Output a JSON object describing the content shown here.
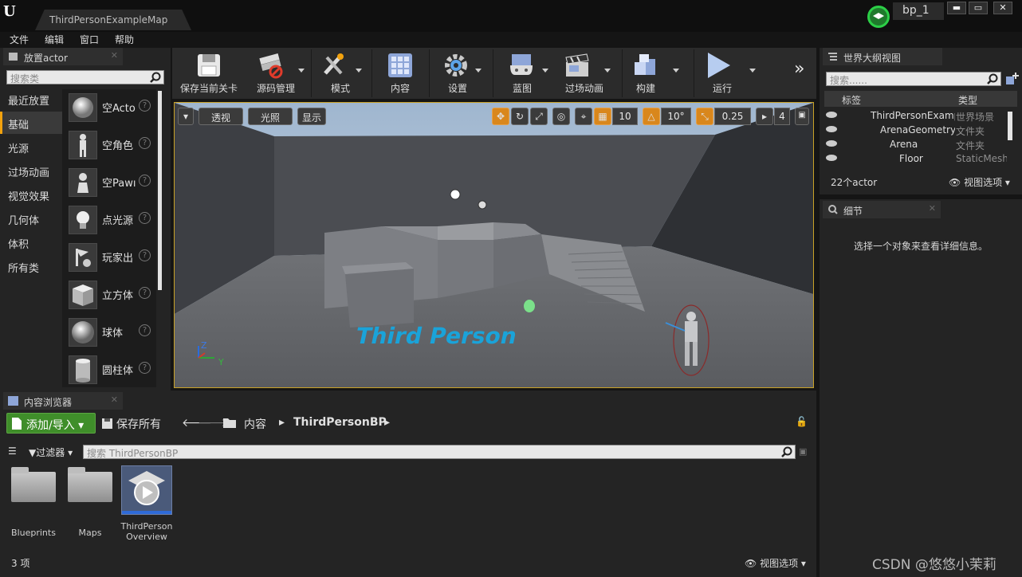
{
  "window": {
    "map_tab": "ThirdPersonExampleMap",
    "project_name": "bp_1",
    "minimize": "▬",
    "maximize": "▭",
    "close": "✕"
  },
  "menu": [
    "文件",
    "编辑",
    "窗口",
    "帮助"
  ],
  "place_actor": {
    "tab_title": "放置actor",
    "search_placeholder": "搜索类",
    "categories": [
      "最近放置",
      "基础",
      "光源",
      "过场动画",
      "视觉效果",
      "几何体",
      "体积",
      "所有类"
    ],
    "active_category": "基础",
    "actors": [
      "空Acto",
      "空角色",
      "空Pawı",
      "点光源",
      "玩家出",
      "立方体",
      "球体",
      "圆柱体"
    ],
    "help_glyph": "?"
  },
  "toolbar": {
    "items": [
      "保存当前关卡",
      "源码管理",
      "模式",
      "内容",
      "设置",
      "蓝图",
      "过场动画",
      "构建",
      "运行"
    ],
    "more": "»"
  },
  "viewport": {
    "perspective": "透视",
    "lit": "光照",
    "show": "显示",
    "grid_snap": "10",
    "rotation_snap": "10°",
    "scale_snap": "0.25",
    "camera_speed": "4",
    "floor_text": "Third Person",
    "axis_z": "Z",
    "axis_y": "Y"
  },
  "outliner": {
    "tab_title": "世界大纲视图",
    "search_placeholder": "搜索......",
    "col_label": "标签",
    "col_type": "类型",
    "rows": [
      {
        "name": "ThirdPersonExampleMap",
        "type": "世界场景"
      },
      {
        "name": "ArenaGeometry",
        "type": "文件夹"
      },
      {
        "name": "Arena",
        "type": "文件夹"
      },
      {
        "name": "Floor",
        "type": "StaticMesh"
      }
    ],
    "count": "22个actor",
    "view_options": "视图选项"
  },
  "details": {
    "tab_title": "细节",
    "empty_message": "选择一个对象来查看详细信息。"
  },
  "content_browser": {
    "tab_title": "内容浏览器",
    "add_import": "添加/导入",
    "save_all": "保存所有",
    "crumbs": [
      "内容",
      "ThirdPersonBP"
    ],
    "filters": "过滤器",
    "search_placeholder": "搜索 ThirdPersonBP",
    "assets": [
      "Blueprints",
      "Maps",
      "ThirdPerson Overview"
    ],
    "count": "3 项",
    "view_options": "视图选项"
  },
  "watermark": "CSDN @悠悠小茉莉"
}
